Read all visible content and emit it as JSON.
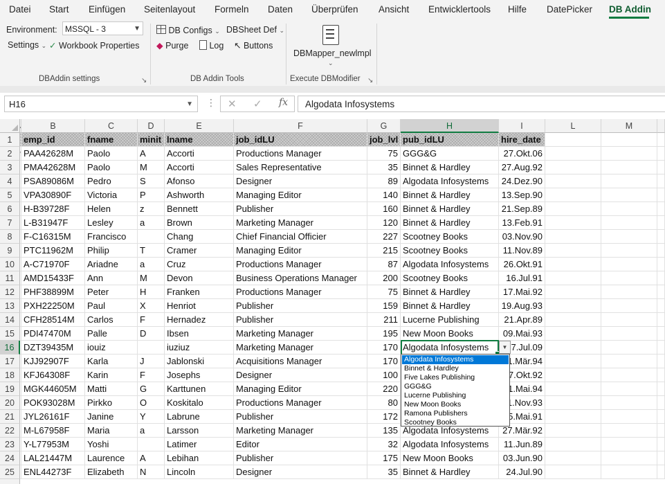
{
  "menu": [
    "Datei",
    "Start",
    "Einfügen",
    "Seitenlayout",
    "Formeln",
    "Daten",
    "Überprüfen",
    "Ansicht",
    "Entwicklertools",
    "Hilfe",
    "DatePicker",
    "DB Addin"
  ],
  "ribbon": {
    "environment_label": "Environment:",
    "environment_value": "MSSQL - 3",
    "settings_label": "Settings",
    "workbook_properties_label": "Workbook Properties",
    "group_settings_label": "DBAddin settings",
    "db_configs_label": "DB Configs",
    "dbsheet_def_label": "DBSheet Def",
    "purge_label": "Purge",
    "log_label": "Log",
    "buttons_label": "Buttons",
    "group_tools_label": "DB Addin Tools",
    "dbmapper_label": "DBMapper_newlmpl",
    "group_execute_label": "Execute DBModifier"
  },
  "formula_bar": {
    "name_box": "H16",
    "value": "Algodata Infosystems"
  },
  "sheet": {
    "columns": [
      "A",
      "B",
      "C",
      "D",
      "E",
      "F",
      "G",
      "H",
      "I",
      "L",
      "M"
    ],
    "selected_column": "H",
    "selected_row": "16",
    "header_row": [
      "emp_id",
      "fname",
      "minit",
      "lname",
      "job_idLU",
      "job_lvl",
      "pub_idLU",
      "hire_date"
    ],
    "rows": [
      {
        "n": "2",
        "a": "9",
        "cells": [
          "PAA42628M",
          "Paolo",
          "A",
          "Accorti",
          "Productions Manager",
          "75",
          "GGG&G",
          "27.Okt.06"
        ]
      },
      {
        "n": "3",
        "a": "",
        "cells": [
          "PMA42628M",
          "Paolo",
          "M",
          "Accorti",
          "Sales Representative",
          "35",
          "Binnet & Hardley",
          "27.Aug.92"
        ]
      },
      {
        "n": "4",
        "a": "",
        "cells": [
          "PSA89086M",
          "Pedro",
          "S",
          "Afonso",
          "Designer",
          "89",
          "Algodata Infosystems",
          "24.Dez.90"
        ]
      },
      {
        "n": "5",
        "a": "",
        "cells": [
          "VPA30890F",
          "Victoria",
          "P",
          "Ashworth",
          "Managing Editor",
          "140",
          "Binnet & Hardley",
          "13.Sep.90"
        ]
      },
      {
        "n": "6",
        "a": "",
        "cells": [
          "H-B39728F",
          "Helen",
          "z",
          "Bennett",
          "Publisher",
          "160",
          "Binnet & Hardley",
          "21.Sep.89"
        ]
      },
      {
        "n": "7",
        "a": "",
        "cells": [
          "L-B31947F",
          "Lesley",
          "a",
          "Brown",
          "Marketing Manager",
          "120",
          "Binnet & Hardley",
          "13.Feb.91"
        ]
      },
      {
        "n": "8",
        "a": "",
        "cells": [
          "F-C16315M",
          "Francisco",
          "",
          "Chang",
          "Chief Financial Officier",
          "227",
          "Scootney Books",
          "03.Nov.90"
        ]
      },
      {
        "n": "9",
        "a": "",
        "cells": [
          "PTC11962M",
          "Philip",
          "T",
          "Cramer",
          "Managing Editor",
          "215",
          "Scootney Books",
          "11.Nov.89"
        ]
      },
      {
        "n": "10",
        "a": "",
        "cells": [
          "A-C71970F",
          "Ariadne",
          "a",
          "Cruz",
          "Productions Manager",
          "87",
          "Algodata Infosystems",
          "26.Okt.91"
        ]
      },
      {
        "n": "11",
        "a": "",
        "cells": [
          "AMD15433F",
          "Ann",
          "M",
          "Devon",
          "Business Operations Manager",
          "200",
          "Scootney Books",
          "16.Jul.91"
        ]
      },
      {
        "n": "12",
        "a": "",
        "cells": [
          "PHF38899M",
          "Peter",
          "H",
          "Franken",
          "Productions Manager",
          "75",
          "Binnet & Hardley",
          "17.Mai.92"
        ]
      },
      {
        "n": "13",
        "a": "",
        "cells": [
          "PXH22250M",
          "Paul",
          "X",
          "Henriot",
          "Publisher",
          "159",
          "Binnet & Hardley",
          "19.Aug.93"
        ]
      },
      {
        "n": "14",
        "a": "",
        "cells": [
          "CFH28514M",
          "Carlos",
          "F",
          "Hernadez",
          "Publisher",
          "211",
          "Lucerne Publishing",
          "21.Apr.89"
        ]
      },
      {
        "n": "15",
        "a": "",
        "cells": [
          "PDI47470M",
          "Palle",
          "D",
          "Ibsen",
          "Marketing Manager",
          "195",
          "New Moon Books",
          "09.Mai.93"
        ]
      },
      {
        "n": "16",
        "a": "",
        "cells": [
          "DZT39435M",
          "iouiz",
          "",
          "iuziuz",
          "Marketing Manager",
          "170",
          "Algodata Infosystems",
          "17.Jul.09"
        ]
      },
      {
        "n": "17",
        "a": "",
        "cells": [
          "KJJ92907F",
          "Karla",
          "J",
          "Jablonski",
          "Acquisitions Manager",
          "170",
          "",
          "1.Mär.94"
        ]
      },
      {
        "n": "18",
        "a": "",
        "cells": [
          "KFJ64308F",
          "Karin",
          "F",
          "Josephs",
          "Designer",
          "100",
          "",
          "7.Okt.92"
        ]
      },
      {
        "n": "19",
        "a": "",
        "cells": [
          "MGK44605M",
          "Matti",
          "G",
          "Karttunen",
          "Managing Editor",
          "220",
          "",
          "1.Mai.94"
        ]
      },
      {
        "n": "20",
        "a": "",
        "cells": [
          "POK93028M",
          "Pirkko",
          "O",
          "Koskitalo",
          "Productions Manager",
          "80",
          "",
          "1.Nov.93"
        ]
      },
      {
        "n": "21",
        "a": "",
        "cells": [
          "JYL26161F",
          "Janine",
          "Y",
          "Labrune",
          "Publisher",
          "172",
          "",
          "5.Mai.91"
        ]
      },
      {
        "n": "22",
        "a": "",
        "cells": [
          "M-L67958F",
          "Maria",
          "a",
          "Larsson",
          "Marketing Manager",
          "135",
          "Algodata Infosystems",
          "27.Mär.92"
        ]
      },
      {
        "n": "23",
        "a": "",
        "cells": [
          "Y-L77953M",
          "Yoshi",
          "",
          "Latimer",
          "Editor",
          "32",
          "Algodata Infosystems",
          "11.Jun.89"
        ]
      },
      {
        "n": "24",
        "a": "",
        "cells": [
          "LAL21447M",
          "Laurence",
          "A",
          "Lebihan",
          "Publisher",
          "175",
          "New Moon Books",
          "03.Jun.90"
        ]
      },
      {
        "n": "25",
        "a": "",
        "cells": [
          "ENL44273F",
          "Elizabeth",
          "N",
          "Lincoln",
          "Designer",
          "35",
          "Binnet & Hardley",
          "24.Jul.90"
        ]
      }
    ]
  },
  "dropdown": {
    "options": [
      "Algodata Infosystems",
      "Binnet & Hardley",
      "Five Lakes Publishing",
      "GGG&G",
      "Lucerne Publishing",
      "New Moon Books",
      "Ramona Publishers",
      "Scootney Books"
    ],
    "selected_index": 0
  },
  "colors": {
    "accent": "#107c41",
    "selection": "#0078d7"
  }
}
